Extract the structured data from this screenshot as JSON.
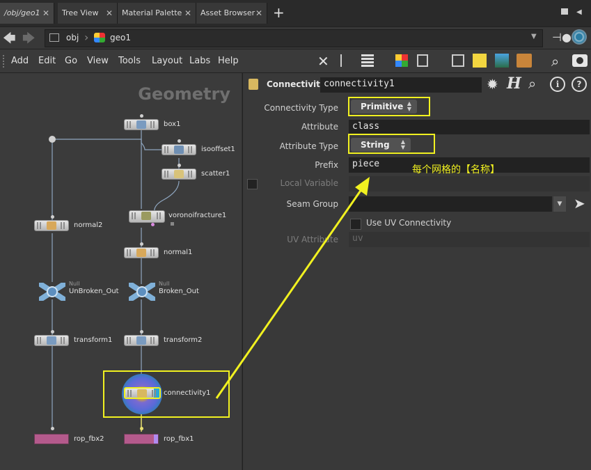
{
  "tabs": [
    {
      "label": "/obj/geo1",
      "active": true
    },
    {
      "label": "Tree View"
    },
    {
      "label": "Material Palette"
    },
    {
      "label": "Asset Browser"
    }
  ],
  "path": {
    "root": "obj",
    "current": "geo1"
  },
  "menu": [
    "Add",
    "Edit",
    "Go",
    "View",
    "Tools",
    "Layout",
    "Labs",
    "Help"
  ],
  "network": {
    "context_label": "Geometry",
    "nodes": {
      "box1": "box1",
      "isooffset1": "isooffset1",
      "scatter1": "scatter1",
      "voronoifracture1": "voronoifracture1",
      "normal2": "normal2",
      "normal1": "normal1",
      "unbroken_out": "UnBroken_Out",
      "broken_out": "Broken_Out",
      "null_type": "Null",
      "transform1": "transform1",
      "transform2": "transform2",
      "connectivity1": "connectivity1",
      "rop_fbx2": "rop_fbx2",
      "rop_fbx1": "rop_fbx1"
    }
  },
  "params": {
    "node_type": "Connectivity",
    "node_name": "connectivity1",
    "connectivity_type": {
      "label": "Connectivity Type",
      "value": "Primitive"
    },
    "attribute": {
      "label": "Attribute",
      "value": "class"
    },
    "attribute_type": {
      "label": "Attribute Type",
      "value": "String"
    },
    "prefix": {
      "label": "Prefix",
      "value": "piece"
    },
    "local_variable": {
      "label": "Local Variable"
    },
    "seam_group": {
      "label": "Seam Group",
      "value": ""
    },
    "use_uv": {
      "label": "Use UV Connectivity"
    },
    "uv_attribute": {
      "label": "UV Attribute",
      "value": "uv"
    }
  },
  "annotation": {
    "text": "每个网格的【名称】",
    "color": "#f1f120"
  },
  "colors": {
    "highlight": "#f1f120",
    "rop": "#b45a8c",
    "accent": "#2aa7d6"
  }
}
